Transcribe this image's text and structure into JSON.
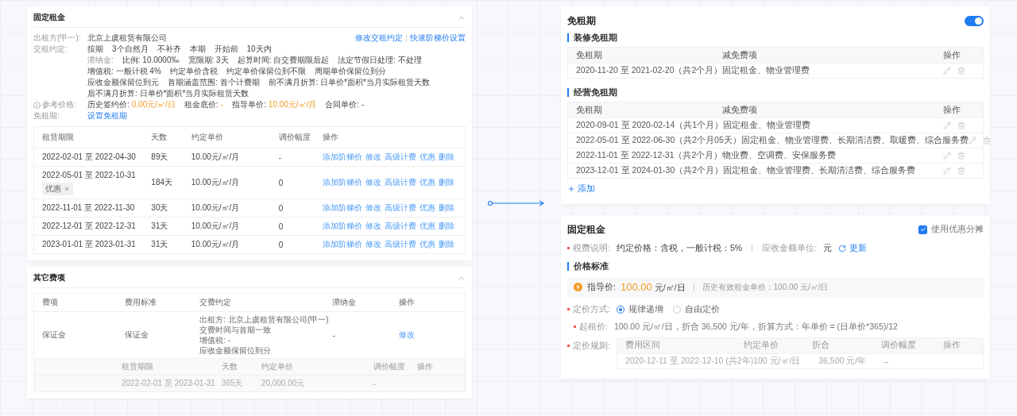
{
  "left_top": {
    "title": "固定租金",
    "links": [
      "修改交租约定",
      "快速阶梯价设置"
    ],
    "lessor": {
      "label": "出租方(甲一):",
      "value": "北京上虞租赁有限公司"
    },
    "terms": {
      "label": "交租约定:",
      "values": [
        "按期",
        "3个自然月",
        "不补齐",
        "本期",
        "开始前",
        "10天内"
      ]
    },
    "late_fee": [
      "滞纳金:",
      "比例: 10.0000‰",
      "宽限期: 3天",
      "起算时间: 自交费期限后起",
      "法定节假日处理: 不处理",
      "增值税: 一般计税 4%",
      "约定单价含税",
      "约定单价保留位到不限",
      "周期单价保留位到分",
      "应收金额保留位到元",
      "首期涵盖范围: 首个计费期",
      "前不满月折算: 日单价*面积*当月实际租赁天数",
      "后不满月折算: 日单价*面积*当月实际租赁天数"
    ],
    "reference": {
      "label": "参考价格:",
      "items": [
        {
          "label": "历史签约价:",
          "value": "0.00元/㎡/日",
          "highlight": true
        },
        {
          "label": "租金底价:",
          "value": "-",
          "highlight": true
        },
        {
          "label": "指导单价:",
          "value": "10.00元/㎡/月",
          "highlight": true
        },
        {
          "label": "合同单价:",
          "value": "-",
          "highlight": false
        }
      ]
    },
    "free_rent": {
      "label": "免租期:",
      "link": "设置免租期"
    },
    "table": {
      "columns": [
        "租赁期限",
        "天数",
        "约定单价",
        "调价幅度",
        "操作"
      ],
      "rows": [
        {
          "period": "2022-02-01 至 2022-04-30",
          "days": "89天",
          "price": "10.00元/㎡/月",
          "adjust": "-",
          "actions": [
            "添加阶梯价",
            "修改",
            "高级计费",
            "优惠",
            "删除"
          ]
        },
        {
          "period": "2022-05-01 至 2022-10-31",
          "tag": "优惠",
          "days": "184天",
          "price": "10.00元/㎡/月",
          "adjust": "0",
          "actions": [
            "添加阶梯价",
            "修改",
            "高级计费",
            "优惠",
            "删除"
          ]
        },
        {
          "period": "2022-11-01 至 2022-11-30",
          "days": "30天",
          "price": "10.00元/㎡/月",
          "adjust": "0",
          "actions": [
            "添加阶梯价",
            "修改",
            "高级计费",
            "优惠",
            "删除"
          ]
        },
        {
          "period": "2022-12-01 至 2022-12-31",
          "days": "31天",
          "price": "10.00元/㎡/月",
          "adjust": "0",
          "actions": [
            "添加阶梯价",
            "修改",
            "高级计费",
            "优惠",
            "删除"
          ]
        },
        {
          "period": "2023-01-01 至 2023-01-31",
          "days": "31天",
          "price": "10.00元/㎡/月",
          "adjust": "0",
          "actions": [
            "添加阶梯价",
            "修改",
            "高级计费",
            "优惠",
            "删除"
          ]
        }
      ]
    }
  },
  "left_bottom": {
    "title": "其它费项",
    "columns": [
      "费项",
      "费用标准",
      "交费约定",
      "滞纳金",
      "操作"
    ],
    "rows": [
      {
        "item": "保证金",
        "standard": "保证金",
        "terms": [
          "出租方: 北京上虞租赁有限公司(甲一)",
          "交费时间与首期一致",
          "增值税: -",
          "应收金额保留位到分"
        ],
        "late_fee": "-",
        "action": "修改"
      }
    ],
    "sub_table": {
      "columns": [
        "租赁期限",
        "天数",
        "约定单价",
        "调价幅度",
        "操作"
      ],
      "rows": [
        [
          "2022-02-01 至 2023-01-31",
          "365天",
          "20,000.00元",
          "-"
        ]
      ]
    }
  },
  "right_top": {
    "title": "免租期",
    "toggle_on": true,
    "sections": [
      {
        "title": "装修免租期",
        "columns": [
          "免租期",
          "减免费项",
          "操作"
        ],
        "rows": [
          {
            "period": "2020-11-20 至 2021-02-20（共2个月）",
            "items": "固定租金、物业管理费"
          }
        ]
      },
      {
        "title": "经营免租期",
        "columns": [
          "免租期",
          "减免费项",
          "操作"
        ],
        "rows": [
          {
            "period": "2020-09-01 至 2020-02-14（共1个月）",
            "items": "固定租金、物业管理费"
          },
          {
            "period": "2022-05-01 至 2022-06-30（共2个月05天）",
            "items": "固定租金、物业管理费、长期清洁费、取暖费、综合服务费"
          },
          {
            "period": "2022-11-01 至 2022-12-31（共2个月）",
            "items": "物业费、空调费、安保服务费"
          },
          {
            "period": "2023-12-01 至 2024-01-30（共2个月）",
            "items": "固定租金、物业管理费、长期清洁费、综合服务费"
          }
        ]
      }
    ],
    "add": "添加"
  },
  "right_bottom": {
    "title": "固定租金",
    "checkbox": {
      "label": "使用优惠分摊",
      "checked": true
    },
    "tax": {
      "label": "税费说明:",
      "required": true,
      "value": "约定价格：含税，一般计税：5%",
      "unit_label": "应收金额单位:",
      "unit": "元",
      "refresh": "更新"
    },
    "section": "价格标准",
    "guide": {
      "label": "指导价:",
      "price": "100.00",
      "unit": "元/㎡/日",
      "history": "历史有效租金单价：100.00 元/㎡/日"
    },
    "pricing": {
      "label": "定价方式:",
      "required": true,
      "options": [
        {
          "label": "规律递增",
          "selected": true
        },
        {
          "label": "自由定价",
          "selected": false
        }
      ]
    },
    "start_price": {
      "label": "起租价:",
      "required": true,
      "value": "100.00 元/㎡/日，折合 36,500 元/年，折算方式：年单价 = (日单价*365)/12"
    },
    "rules": {
      "label": "定价规则:",
      "required": true,
      "columns": [
        "费用区间",
        "约定单价",
        "折合",
        "调价幅度",
        "操作"
      ],
      "rows": [
        [
          "2020-12-11 至 2022-12-10 (共2年)",
          "100 元/㎡/日",
          "36,500 元/年",
          "–"
        ]
      ]
    }
  }
}
